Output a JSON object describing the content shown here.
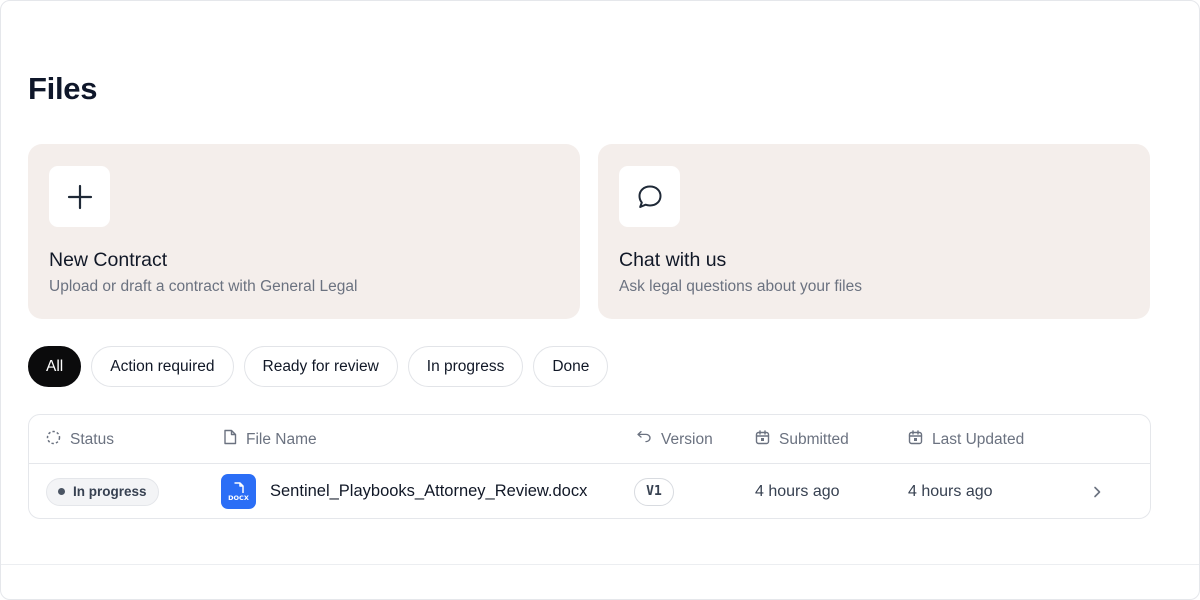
{
  "page": {
    "title": "Files"
  },
  "cards": {
    "new_contract": {
      "icon": "plus-icon",
      "title": "New Contract",
      "subtitle": "Upload or draft a contract with General Legal"
    },
    "chat": {
      "icon": "chat-bubble-icon",
      "title": "Chat with us",
      "subtitle": "Ask legal questions about your files"
    }
  },
  "filters": {
    "selected": "All",
    "items": [
      "All",
      "Action required",
      "Ready for review",
      "In progress",
      "Done"
    ]
  },
  "table": {
    "columns": {
      "status": {
        "label": "Status",
        "icon": "dashed-circle-icon"
      },
      "file_name": {
        "label": "File Name",
        "icon": "document-icon"
      },
      "version": {
        "label": "Version",
        "icon": "undo-arrow-icon"
      },
      "submitted": {
        "label": "Submitted",
        "icon": "calendar-icon"
      },
      "last_updated": {
        "label": "Last Updated",
        "icon": "calendar-icon"
      }
    },
    "rows": [
      {
        "status": "In progress",
        "file_type": "DOCX",
        "file_name": "Sentinel_Playbooks_Attorney_Review.docx",
        "version": "V1",
        "submitted": "4 hours ago",
        "last_updated": "4 hours ago"
      }
    ]
  },
  "colors": {
    "card_background": "#f4eeeb",
    "active_filter": "#0b0b0c",
    "file_icon": "#2b6ef6"
  }
}
